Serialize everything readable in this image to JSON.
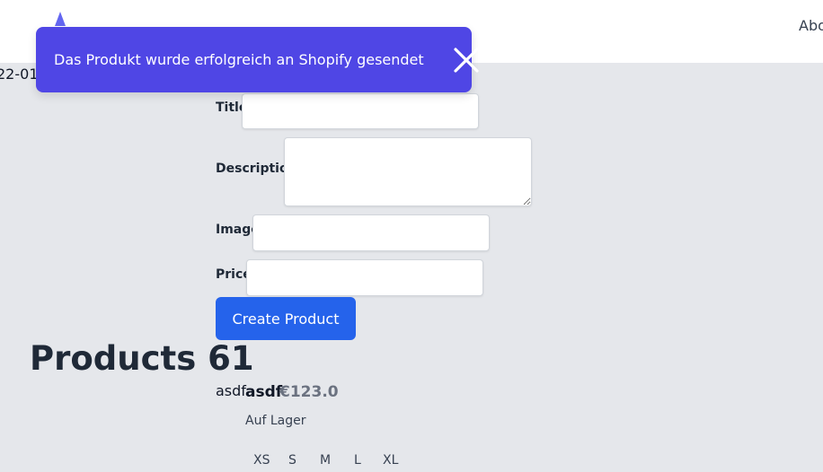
{
  "nav": {
    "logo_icon": "mountain-logo-icon",
    "about_label": "Abo"
  },
  "date_fragment": "22-01",
  "toast": {
    "message": "Das Produkt wurde erfolgreich an Shopify gesendet",
    "close_icon": "close-icon",
    "color": "#4f46e5"
  },
  "form": {
    "title_label": "Title",
    "title_value": "",
    "description_label": "Description",
    "description_value": "",
    "image_label": "Image",
    "image_value": "",
    "price_label": "Price",
    "price_value": "",
    "submit_label": "Create Product",
    "submit_color": "#2563eb"
  },
  "products": {
    "heading": "Products 61",
    "items": [
      {
        "image_alt": "asdf",
        "name": "asdf",
        "price": "€123.0",
        "stock": "Auf Lager",
        "sizes": [
          "XS",
          "S",
          "M",
          "L",
          "XL"
        ]
      }
    ]
  }
}
